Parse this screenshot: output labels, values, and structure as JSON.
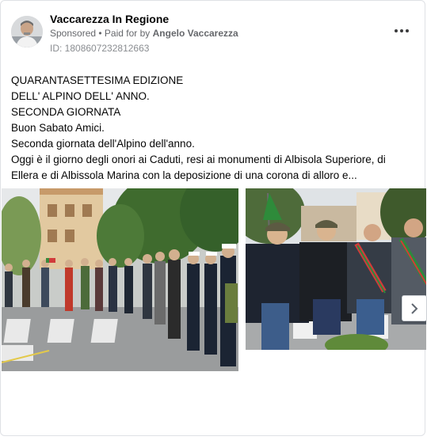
{
  "post": {
    "page_name": "Vaccarezza In Regione",
    "sponsored_label": "Sponsored",
    "paid_prefix": " • Paid for by ",
    "payer": "Angelo Vaccarezza",
    "ad_id": "ID: 1808607232812663",
    "more_icon": "more-horizontal-icon",
    "text_lines": [
      "QUARANTASETTESIMA EDIZIONE",
      "DELL' ALPINO DELL' ANNO.",
      "SECONDA GIORNATA",
      "Buon Sabato Amici.",
      "Seconda giornata dell'Alpino dell'anno.",
      "Oggi è il giorno degli onori ai Caduti, resi ai monumenti di Albisola Superiore, di",
      "Ellera e di Albissola Marina con la deposizione di una corona di alloro e..."
    ]
  },
  "carousel": {
    "next_icon": "chevron-right-icon"
  }
}
